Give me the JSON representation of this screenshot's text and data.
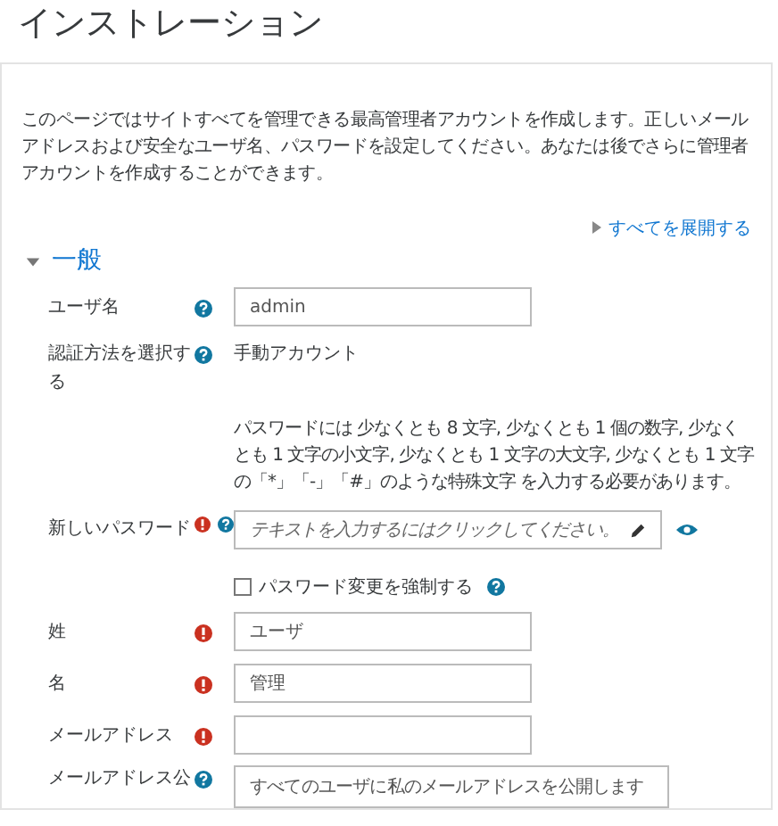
{
  "page_title": "インストレーション",
  "intro": "このページではサイトすべてを管理できる最高管理者アカウントを作成します。正しいメールアドレスおよび安全なユーザ名、パスワードを設定してください。あなたは後でさらに管理者アカウントを作成することができます。",
  "expand_all": "すべてを展開する",
  "section": {
    "title": "一般",
    "expanded": true
  },
  "rows": [
    {
      "kind": "text",
      "label": "ユーザ名",
      "required": false,
      "help": true,
      "value": "admin"
    },
    {
      "kind": "static",
      "label": "認証方法を選択する",
      "required": false,
      "help": true,
      "value": "手動アカウント"
    },
    {
      "kind": "info",
      "text": "パスワードには 少なくとも 8 文字, 少なくとも 1 個の数字, 少なくとも 1 文字の小文字, 少なくとも 1 文字の大文字, 少なくとも 1 文字の「*」「-」「#」のような特殊文字 を入力する必要があります。"
    },
    {
      "kind": "password",
      "label": "新しいパスワード",
      "required": true,
      "help": true,
      "placeholder": "テキストを入力するにはクリックしてください。"
    },
    {
      "kind": "checkbox",
      "label": "パスワード変更を強制する",
      "checked": false,
      "help": true
    },
    {
      "kind": "text",
      "label": "姓",
      "required": true,
      "help": false,
      "value": "ユーザ"
    },
    {
      "kind": "text",
      "label": "名",
      "required": true,
      "help": false,
      "value": "管理"
    },
    {
      "kind": "text",
      "label": "メールアドレス",
      "required": true,
      "help": false,
      "value": ""
    },
    {
      "kind": "select",
      "label": "メールアドレス公",
      "required": false,
      "help": true,
      "value": "すべてのユーザに私のメールアドレスを公開します"
    }
  ]
}
